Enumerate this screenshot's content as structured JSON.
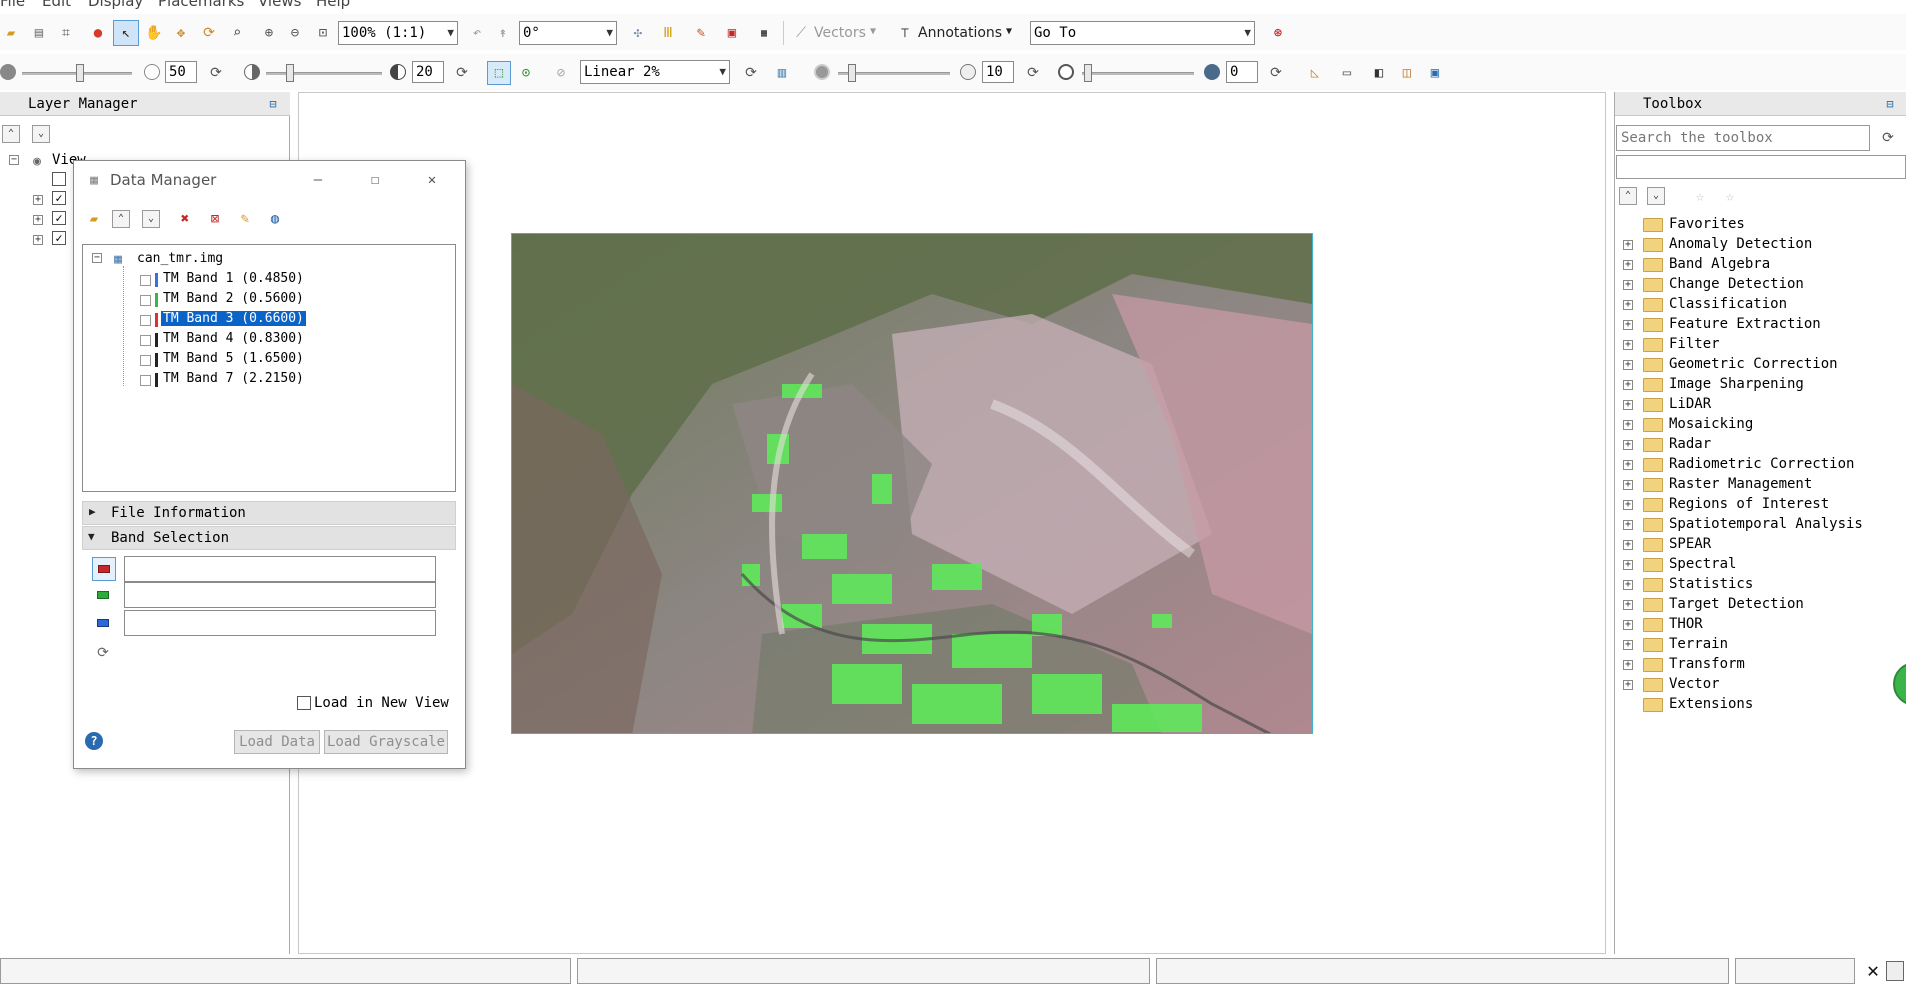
{
  "menubar": {
    "items": [
      "File",
      "Edit",
      "Display",
      "Placemarks",
      "Views",
      "Help"
    ]
  },
  "toolbar1": {
    "zoom_value": "100% (1:1)",
    "rotation_value": "0°",
    "vectors_label": "Vectors",
    "annotations_label": "Annotations",
    "goto_value": "Go To"
  },
  "toolbar2": {
    "brightness_value": "50",
    "contrast_value": "20",
    "stretch_value": "Linear 2%",
    "sharpen_value": "10",
    "transparency_value": "0"
  },
  "layer_manager": {
    "title": "Layer Manager",
    "view_label": "View"
  },
  "data_manager": {
    "title": "Data Manager",
    "file_name": "can_tmr.img",
    "bands": [
      {
        "label": "TM Band 1 (0.4850)",
        "color": "#3a6fd8"
      },
      {
        "label": "TM Band 2 (0.5600)",
        "color": "#39b54a"
      },
      {
        "label": "TM Band 3 (0.6600)",
        "color": "#d9342b"
      },
      {
        "label": "TM Band 4 (0.8300)",
        "color": "#222222"
      },
      {
        "label": "TM Band 5 (1.6500)",
        "color": "#222222"
      },
      {
        "label": "TM Band 7 (2.2150)",
        "color": "#222222"
      }
    ],
    "selected_band_index": 2,
    "file_info_label": "File Information",
    "band_selection_label": "Band Selection",
    "load_new_view_label": "Load in New View",
    "load_data_label": "Load Data",
    "load_grayscale_label": "Load Grayscale"
  },
  "toolbox": {
    "title": "Toolbox",
    "search_placeholder": "Search the toolbox",
    "items": [
      "Favorites",
      "Anomaly Detection",
      "Band Algebra",
      "Change Detection",
      "Classification",
      "Feature Extraction",
      "Filter",
      "Geometric Correction",
      "Image Sharpening",
      "LiDAR",
      "Mosaicking",
      "Radar",
      "Radiometric Correction",
      "Raster Management",
      "Regions of Interest",
      "Spatiotemporal Analysis",
      "SPEAR",
      "Spectral",
      "Statistics",
      "Target Detection",
      "THOR",
      "Terrain",
      "Transform",
      "Vector",
      "Extensions"
    ]
  },
  "colors": {
    "selection": "#0a64c8",
    "panel_header": "#e9e9e9",
    "image_border": "#3ab5c9"
  }
}
